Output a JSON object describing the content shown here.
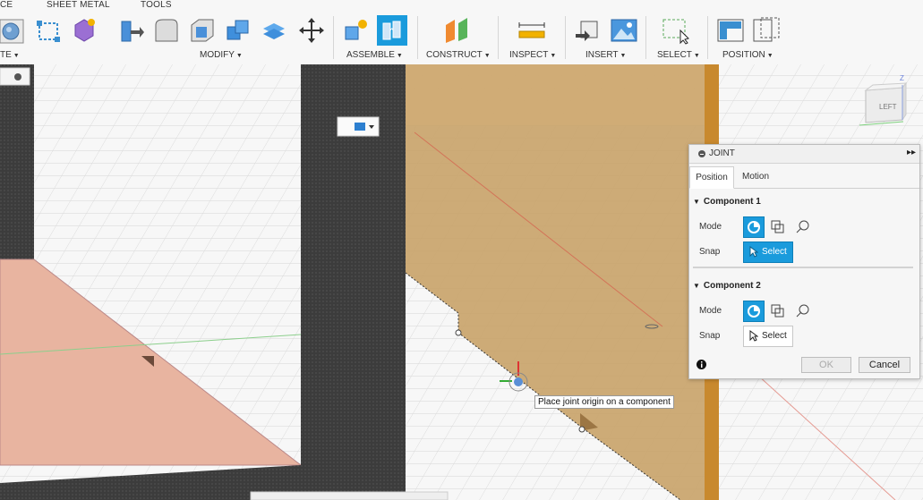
{
  "toolbar": {
    "tabs": {
      "tab_partial": "CE",
      "sheet_metal": "SHEET METAL",
      "tools": "TOOLS"
    },
    "groups": {
      "create_partial": "TE",
      "modify": "MODIFY",
      "assemble": "ASSEMBLE",
      "construct": "CONSTRUCT",
      "inspect": "INSPECT",
      "insert": "INSERT",
      "select": "SELECT",
      "position": "POSITION"
    },
    "icons": [
      "sphere-icon",
      "sketch-rectangle-icon",
      "form-icon",
      "press-pull-icon",
      "fillet-icon",
      "shell-icon",
      "combine-icon",
      "replace-face-icon",
      "move-icon",
      "new-component-icon",
      "joint-icon",
      "offset-plane-icon",
      "measure-icon",
      "insert-derive-icon",
      "insert-image-icon",
      "select-window-icon",
      "capture-position-icon",
      "revert-position-icon"
    ]
  },
  "viewcube": {
    "face_label": "LEFT",
    "axis_label": "Z"
  },
  "joint_panel": {
    "title": "JOINT",
    "tabs": [
      "Position",
      "Motion"
    ],
    "active_tab": "Position",
    "component1": {
      "title": "Component 1",
      "mode_label": "Mode",
      "snap_label": "Snap",
      "snap_button": "Select",
      "snap_active": true
    },
    "component2": {
      "title": "Component 2",
      "mode_label": "Mode",
      "snap_label": "Snap",
      "snap_button": "Select",
      "snap_active": false
    },
    "ok_label": "OK",
    "cancel_label": "Cancel"
  },
  "tooltip": "Place joint origin on a component",
  "colors": {
    "accent": "#1a9bdc",
    "wood": "#c9a46b",
    "sketch_pink": "#e8b4a0",
    "wall_dark": "#3b3b3b"
  }
}
